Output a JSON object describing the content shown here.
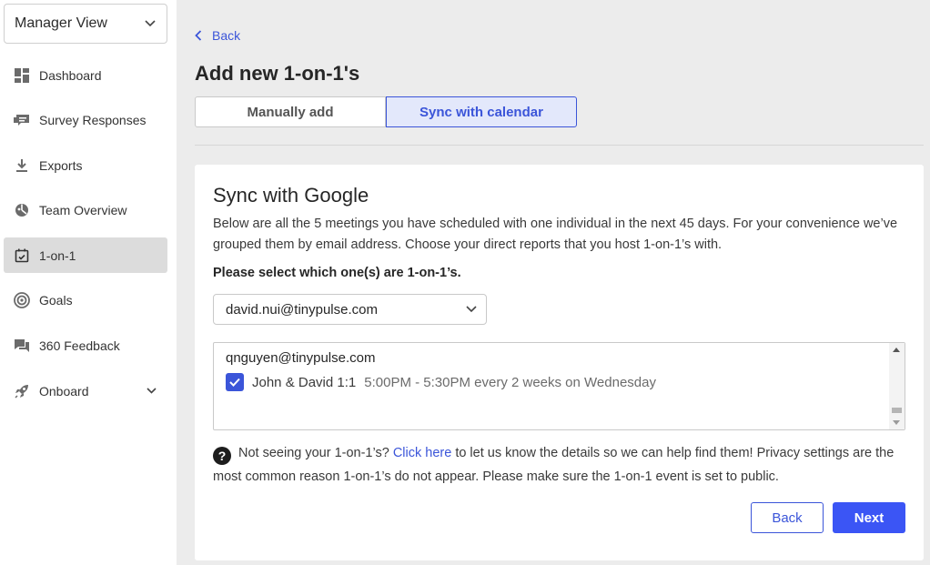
{
  "sidebar": {
    "view_select": {
      "label": "Manager View"
    },
    "items": [
      {
        "label": "Dashboard",
        "icon": "dashboard-icon"
      },
      {
        "label": "Survey Responses",
        "icon": "chat-icon"
      },
      {
        "label": "Exports",
        "icon": "download-icon"
      },
      {
        "label": "Team Overview",
        "icon": "pie-chart-icon"
      },
      {
        "label": "1-on-1",
        "icon": "calendar-check-icon",
        "active": true
      },
      {
        "label": "Goals",
        "icon": "target-icon"
      },
      {
        "label": "360 Feedback",
        "icon": "feedback-icon"
      },
      {
        "label": "Onboard",
        "icon": "rocket-icon",
        "expandable": true
      }
    ]
  },
  "main": {
    "back_label": "Back",
    "title": "Add new 1-on-1's",
    "tabs": [
      {
        "label": "Manually add"
      },
      {
        "label": "Sync with calendar",
        "active": true
      }
    ],
    "card": {
      "title": "Sync with Google",
      "description": "Below are all the 5 meetings you have scheduled with one individual in the next 45 days. For your convenience we’ve grouped them by email address. Choose your direct reports that you host 1-on-1’s with.",
      "select_label": "Please select which one(s) are 1-on-1’s.",
      "email_select_value": "david.nui@tinypulse.com",
      "group_email": "qnguyen@tinypulse.com",
      "meeting": {
        "name": "John & David 1:1",
        "time": "5:00PM - 5:30PM every 2 weeks on Wednesday",
        "checked": true
      },
      "help": {
        "prefix": "Not seeing your 1-on-1’s?",
        "link": "Click here",
        "suffix": "to let us know the details so we can help find them! Privacy settings are the most common reason 1-on-1’s do not appear. Please make sure the 1-on-1 event is set to public."
      },
      "back_button": "Back",
      "next_button": "Next"
    }
  },
  "colors": {
    "accent": "#3b55d9",
    "primary_button": "#3b55f5",
    "active_nav": "#dcdcdc"
  }
}
